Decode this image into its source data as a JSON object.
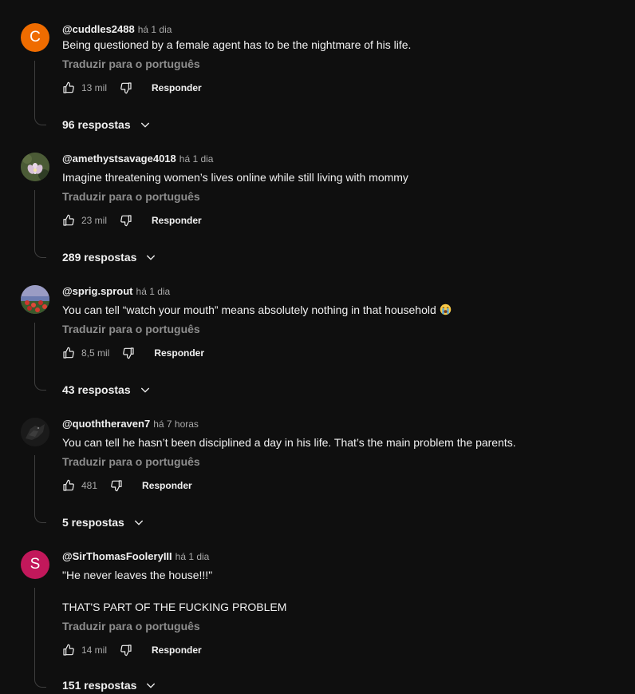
{
  "common": {
    "translate_label": "Traduzir para o português",
    "reply_label": "Responder"
  },
  "comments": [
    {
      "avatar_letter": "C",
      "avatar_color": "#ef6c00",
      "author": "@cuddles2488",
      "time": "há 1 dia",
      "text": [
        "Being questioned by a female agent has to be the nightmare of his life."
      ],
      "likes": "13 mil",
      "replies": "96 respostas"
    },
    {
      "avatar_letter": "",
      "avatar_image": "lotus-flower-avatar",
      "author": "@amethystsavage4018",
      "time": "há 1 dia",
      "text": [
        "Imagine threatening women’s lives online while still living with mommy"
      ],
      "likes": "23 mil",
      "replies": "289 respostas"
    },
    {
      "avatar_letter": "",
      "avatar_image": "flower-field-avatar",
      "author": "@sprig.sprout",
      "time": "há 1 dia",
      "text": [
        "You can tell “watch your mouth” means absolutely nothing in that household"
      ],
      "emoji": "loudly-crying-face",
      "likes": "8,5 mil",
      "replies": "43 respostas"
    },
    {
      "avatar_letter": "",
      "avatar_image": "raven-avatar",
      "author": "@quoththeraven7",
      "time": "há 7 horas",
      "text": [
        "You can tell he hasn’t been disciplined a day in his life. That’s the main problem the parents."
      ],
      "likes": "481",
      "replies": "5 respostas"
    },
    {
      "avatar_letter": "S",
      "avatar_color": "#c2185b",
      "author": "@SirThomasFooleryIII",
      "time": "há 1 dia",
      "text": [
        "\"He never leaves the house!!!\"",
        "",
        "THAT'S PART OF THE FUCKING PROBLEM"
      ],
      "likes": "14 mil",
      "replies": "151 respostas"
    }
  ]
}
